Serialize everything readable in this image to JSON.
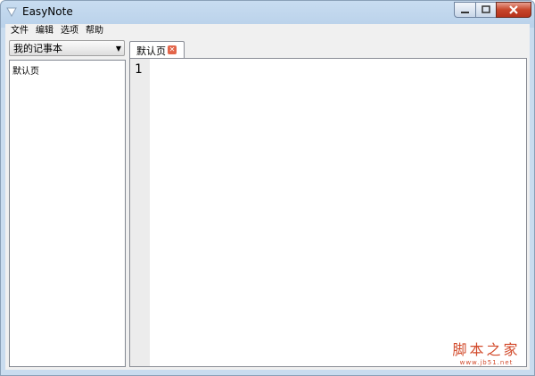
{
  "window": {
    "title": "EasyNote"
  },
  "menubar": {
    "items": [
      "文件",
      "编辑",
      "选项",
      "帮助"
    ]
  },
  "sidebar": {
    "notebook_select": "我的记事本",
    "pages": [
      "默认页"
    ]
  },
  "editor": {
    "tabs": [
      {
        "label": "默认页"
      }
    ],
    "line_numbers": [
      "1"
    ],
    "content": ""
  },
  "watermark": {
    "text_cn": "脚本之家",
    "url": "www.jb51.net"
  },
  "colors": {
    "accent_close": "#c7452a",
    "tab_close": "#e3654a",
    "watermark": "#d24b2c"
  }
}
